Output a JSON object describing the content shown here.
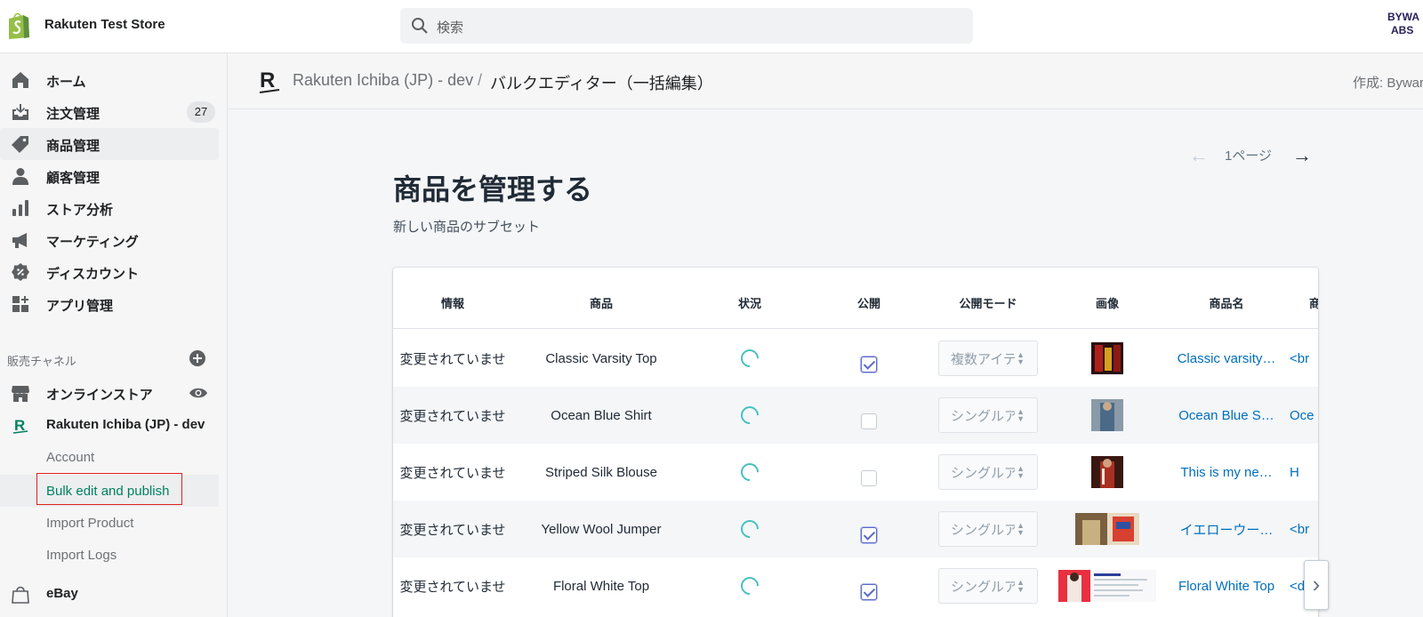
{
  "topbar": {
    "store_name": "Rakuten Test Store",
    "search_placeholder": "検索",
    "avatar_text_line1": "BYWA",
    "avatar_text_line2": "ABS"
  },
  "sidebar": {
    "items": [
      {
        "label": "ホーム",
        "icon": "home-icon"
      },
      {
        "label": "注文管理",
        "icon": "orders-icon",
        "badge": "27"
      },
      {
        "label": "商品管理",
        "icon": "tag-icon",
        "active": true
      },
      {
        "label": "顧客管理",
        "icon": "person-icon"
      },
      {
        "label": "ストア分析",
        "icon": "bar-chart-icon"
      },
      {
        "label": "マーケティング",
        "icon": "megaphone-icon"
      },
      {
        "label": "ディスカウント",
        "icon": "discount-icon"
      },
      {
        "label": "アプリ管理",
        "icon": "apps-icon"
      }
    ],
    "channels_label": "販売チャネル",
    "channels": {
      "online_store": "オンラインストア",
      "rakuten": "Rakuten Ichiba (JP) - dev",
      "ebay": "eBay"
    },
    "sub_items": [
      "Account",
      "Bulk edit and publish",
      "Import Product",
      "Import Logs"
    ]
  },
  "header": {
    "breadcrumb_parent": "Rakuten Ichiba (JP) - dev",
    "breadcrumb_sep": "/",
    "breadcrumb_current": "バルクエディター（一括編集）",
    "byline": "作成: Byward"
  },
  "main": {
    "pager_label": "1ページ",
    "title": "商品を管理する",
    "subtitle": "新しい商品のサブセット",
    "columns": [
      "情報",
      "商品",
      "状況",
      "公開",
      "公開モード",
      "画像",
      "商品名",
      "商"
    ],
    "rows": [
      {
        "info": "変更されていませ",
        "product": "Classic Varsity Top",
        "published": true,
        "mode": "複数アイテム",
        "name": "Classic varsity…",
        "desc": "<br"
      },
      {
        "info": "変更されていませ",
        "product": "Ocean Blue Shirt",
        "published": false,
        "mode": "シングルアイテム",
        "name": "Ocean Blue S…",
        "desc": "Oce"
      },
      {
        "info": "変更されていませ",
        "product": "Striped Silk Blouse",
        "published": false,
        "mode": "シングルアイテム",
        "name": "This is my ne…",
        "desc": "H"
      },
      {
        "info": "変更されていませ",
        "product": "Yellow Wool Jumper",
        "published": true,
        "mode": "シングルアイテム",
        "name": "イエローウー…",
        "desc": "<br"
      },
      {
        "info": "変更されていませ",
        "product": "Floral White Top",
        "published": true,
        "mode": "シングルアイテム",
        "name": "Floral White Top",
        "desc": "<d"
      }
    ]
  },
  "colors": {
    "shopify_green": "#95bf47",
    "active_link": "#008060",
    "link_blue": "#006fbb",
    "spinner_teal": "#47c1bf",
    "checkbox_indigo": "#5c6ac4",
    "highlight_red": "#e02020"
  }
}
